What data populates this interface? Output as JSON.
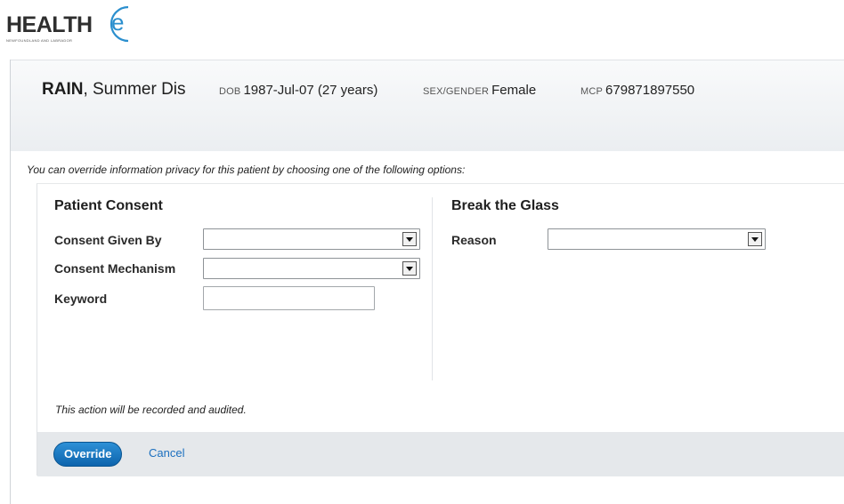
{
  "logo": {
    "word": "HEALTH",
    "letter": "e",
    "subtitle": "NEWFOUNDLAND AND LABRADOR"
  },
  "patient": {
    "last_name": "RAIN",
    "first_names": ", Summer Dis",
    "dob_label": "DOB",
    "dob_value": "1987-Jul-07 (27 years)",
    "sex_label": "SEX/GENDER",
    "sex_value": "Female",
    "mcp_label": "MCP",
    "mcp_value": "679871897550"
  },
  "override": {
    "intro": "You can override information privacy for this patient by choosing one of the following options:",
    "consent": {
      "title": "Patient Consent",
      "given_by_label": "Consent Given By",
      "given_by_value": "",
      "mechanism_label": "Consent Mechanism",
      "mechanism_value": "",
      "keyword_label": "Keyword",
      "keyword_value": ""
    },
    "break_glass": {
      "title": "Break the Glass",
      "reason_label": "Reason",
      "reason_value": ""
    },
    "audit_note": "This action will be recorded and audited.",
    "override_button": "Override",
    "cancel_link": "Cancel"
  },
  "colors": {
    "accent": "#1b6fbf",
    "button": "#0d64ad",
    "logo_ring": "#2b8fce"
  },
  "icons": {
    "dropdown": "chevron-down-icon"
  }
}
